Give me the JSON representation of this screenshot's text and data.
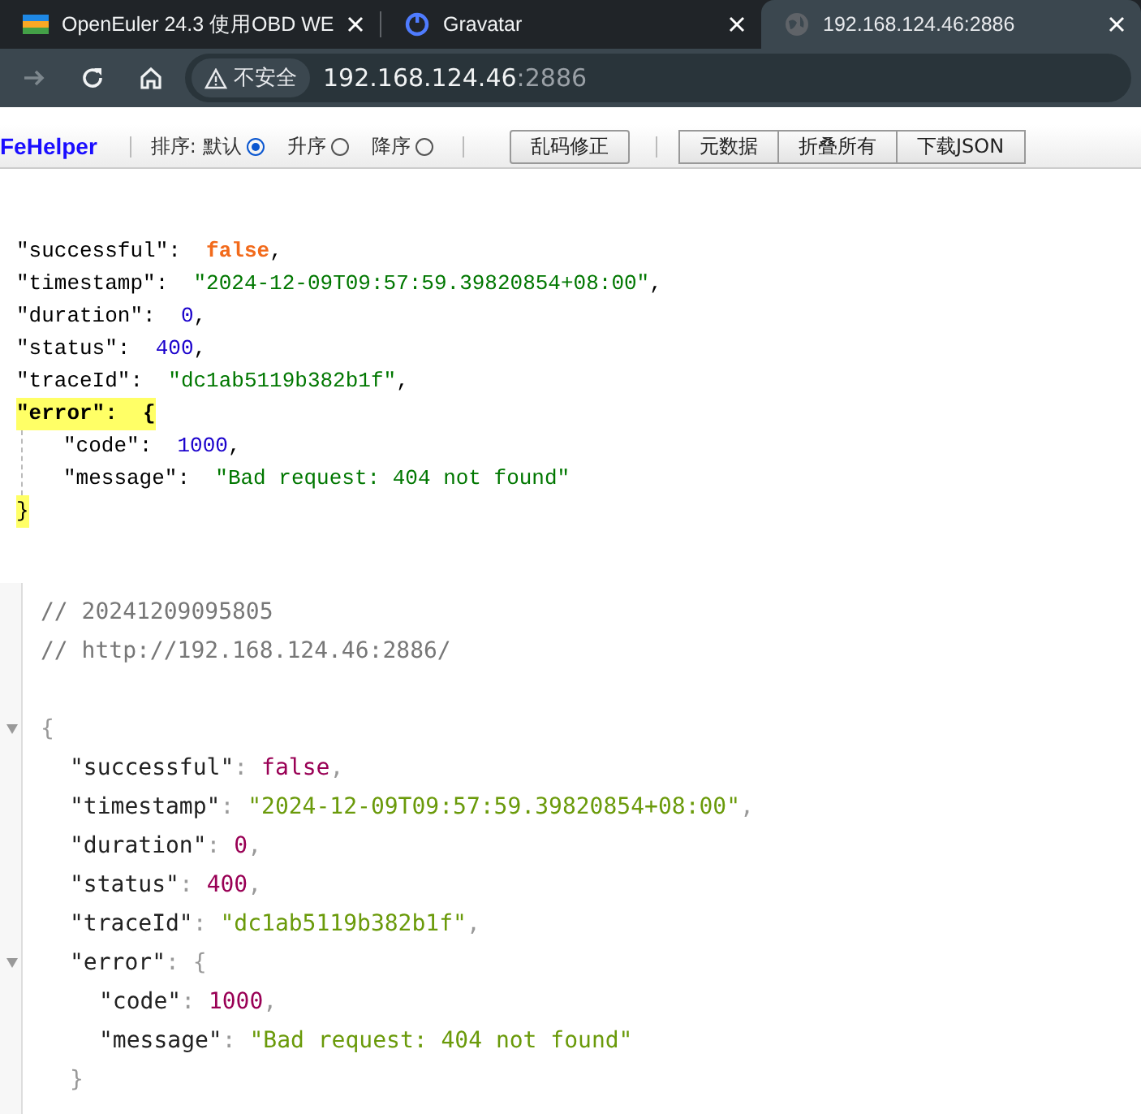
{
  "tabs": [
    {
      "title": "OpenEuler 24.3 使用OBD WE",
      "kind": "stripes",
      "selected": false
    },
    {
      "title": "Gravatar",
      "kind": "power",
      "selected": false
    },
    {
      "title": "192.168.124.46:2886",
      "kind": "globe",
      "selected": true
    }
  ],
  "nav": [
    {
      "kind": "forward",
      "disabled": true
    },
    {
      "kind": "reload",
      "disabled": false
    },
    {
      "kind": "home",
      "disabled": false
    }
  ],
  "address": {
    "security": "不安全",
    "host": "192.168.124.46",
    "port": ":2886"
  },
  "fehelper": {
    "logo": "FeHelper",
    "sort_label": "排序:",
    "sort_options": [
      {
        "label": "默认",
        "selected": true
      },
      {
        "label": "升序",
        "selected": false
      },
      {
        "label": "降序",
        "selected": false
      }
    ],
    "fix_button": "乱码修正",
    "buttons": [
      "元数据",
      "折叠所有",
      "下载JSON"
    ]
  },
  "formatted": {
    "entries": [
      {
        "key": "\"successful\"",
        "colon": ":",
        "value": "false",
        "kind": "boolean",
        "tail": ",",
        "selected": false
      },
      {
        "key": "\"timestamp\"",
        "colon": ":",
        "value": "\"2024-12-09T09:57:59.39820854+08:00\"",
        "kind": "string",
        "tail": ",",
        "selected": false
      },
      {
        "key": "\"duration\"",
        "colon": ":",
        "value": "0",
        "kind": "number",
        "tail": ",",
        "selected": false
      },
      {
        "key": "\"status\"",
        "colon": ":",
        "value": "400",
        "kind": "number",
        "tail": ",",
        "selected": false
      },
      {
        "key": "\"traceId\"",
        "colon": ":",
        "value": "\"dc1ab5119b382b1f\"",
        "kind": "string",
        "tail": ",",
        "selected": false
      },
      {
        "key": "\"error\"",
        "colon": ":",
        "kind": "object",
        "open": "{",
        "close": "}",
        "selected": true,
        "children": [
          {
            "key": "\"code\"",
            "colon": ":",
            "value": "1000",
            "kind": "number",
            "tail": ",",
            "selected": false
          },
          {
            "key": "\"message\"",
            "colon": ":",
            "value": "\"Bad request: 404 not found\"",
            "kind": "string",
            "selected": false
          }
        ]
      }
    ]
  },
  "raw": {
    "comments": [
      "// 20241209095805",
      "// http://192.168.124.46:2886/"
    ],
    "open": "{",
    "entries": [
      {
        "key": "\"successful\"",
        "colon": ":",
        "value": "false",
        "kind": "boolean",
        "tail": ","
      },
      {
        "key": "\"timestamp\"",
        "colon": ":",
        "value": "\"2024-12-09T09:57:59.39820854+08:00\"",
        "kind": "string",
        "tail": ","
      },
      {
        "key": "\"duration\"",
        "colon": ":",
        "value": "0",
        "kind": "number",
        "tail": ","
      },
      {
        "key": "\"status\"",
        "colon": ":",
        "value": "400",
        "kind": "number",
        "tail": ","
      },
      {
        "key": "\"traceId\"",
        "colon": ":",
        "value": "\"dc1ab5119b382b1f\"",
        "kind": "string",
        "tail": ","
      },
      {
        "key": "\"error\"",
        "colon": ":",
        "kind": "object",
        "open": "{",
        "close": "}",
        "children": [
          {
            "key": "\"code\"",
            "colon": ":",
            "value": "1000",
            "kind": "number",
            "tail": ","
          },
          {
            "key": "\"message\"",
            "colon": ":",
            "value": "\"Bad request: 404 not found\"",
            "kind": "string"
          }
        ]
      }
    ]
  }
}
